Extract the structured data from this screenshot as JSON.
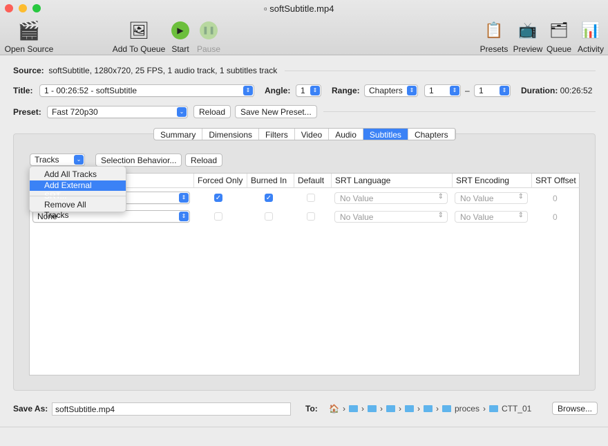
{
  "window": {
    "title": "softSubtitle.mp4"
  },
  "toolbar": {
    "open_source": "Open Source",
    "add_to_queue": "Add To Queue",
    "start": "Start",
    "pause": "Pause",
    "presets": "Presets",
    "preview": "Preview",
    "queue": "Queue",
    "activity": "Activity"
  },
  "source": {
    "label": "Source:",
    "value": "softSubtitle, 1280x720, 25 FPS, 1 audio track, 1 subtitles track"
  },
  "title_row": {
    "label": "Title:",
    "value": "1 - 00:26:52 - softSubtitle",
    "angle_label": "Angle:",
    "angle": "1",
    "range_label": "Range:",
    "range": "Chapters",
    "from": "1",
    "dash": "–",
    "to": "1",
    "duration_label": "Duration:",
    "duration": "00:26:52"
  },
  "preset": {
    "label": "Preset:",
    "value": "Fast 720p30",
    "reload": "Reload",
    "save_new": "Save New Preset..."
  },
  "tabs": [
    {
      "label": "Summary"
    },
    {
      "label": "Dimensions"
    },
    {
      "label": "Filters"
    },
    {
      "label": "Video"
    },
    {
      "label": "Audio"
    },
    {
      "label": "Subtitles",
      "selected": true
    },
    {
      "label": "Chapters"
    }
  ],
  "subtitles": {
    "tracks_button": "Tracks",
    "selection_behavior": "Selection Behavior...",
    "reload": "Reload",
    "menu": [
      "Add All Tracks",
      "Add External SRT...",
      "Remove All Tracks"
    ],
    "columns": [
      "Forced Only",
      "Burned In",
      "Default",
      "SRT Language",
      "SRT Encoding",
      "SRT Offset"
    ],
    "rows": [
      {
        "track": "",
        "forced": true,
        "burned": true,
        "default": false,
        "language": "No Value",
        "encoding": "No Value",
        "offset": "0"
      },
      {
        "track": "None",
        "forced": false,
        "burned": false,
        "default": false,
        "language": "No Value",
        "encoding": "No Value",
        "offset": "0"
      }
    ]
  },
  "save": {
    "label": "Save As:",
    "value": "softSubtitle.mp4",
    "to_label": "To:",
    "path": [
      "proces",
      "CTT_01"
    ],
    "browse": "Browse..."
  },
  "colors": {
    "accent": "#3b82f6"
  }
}
